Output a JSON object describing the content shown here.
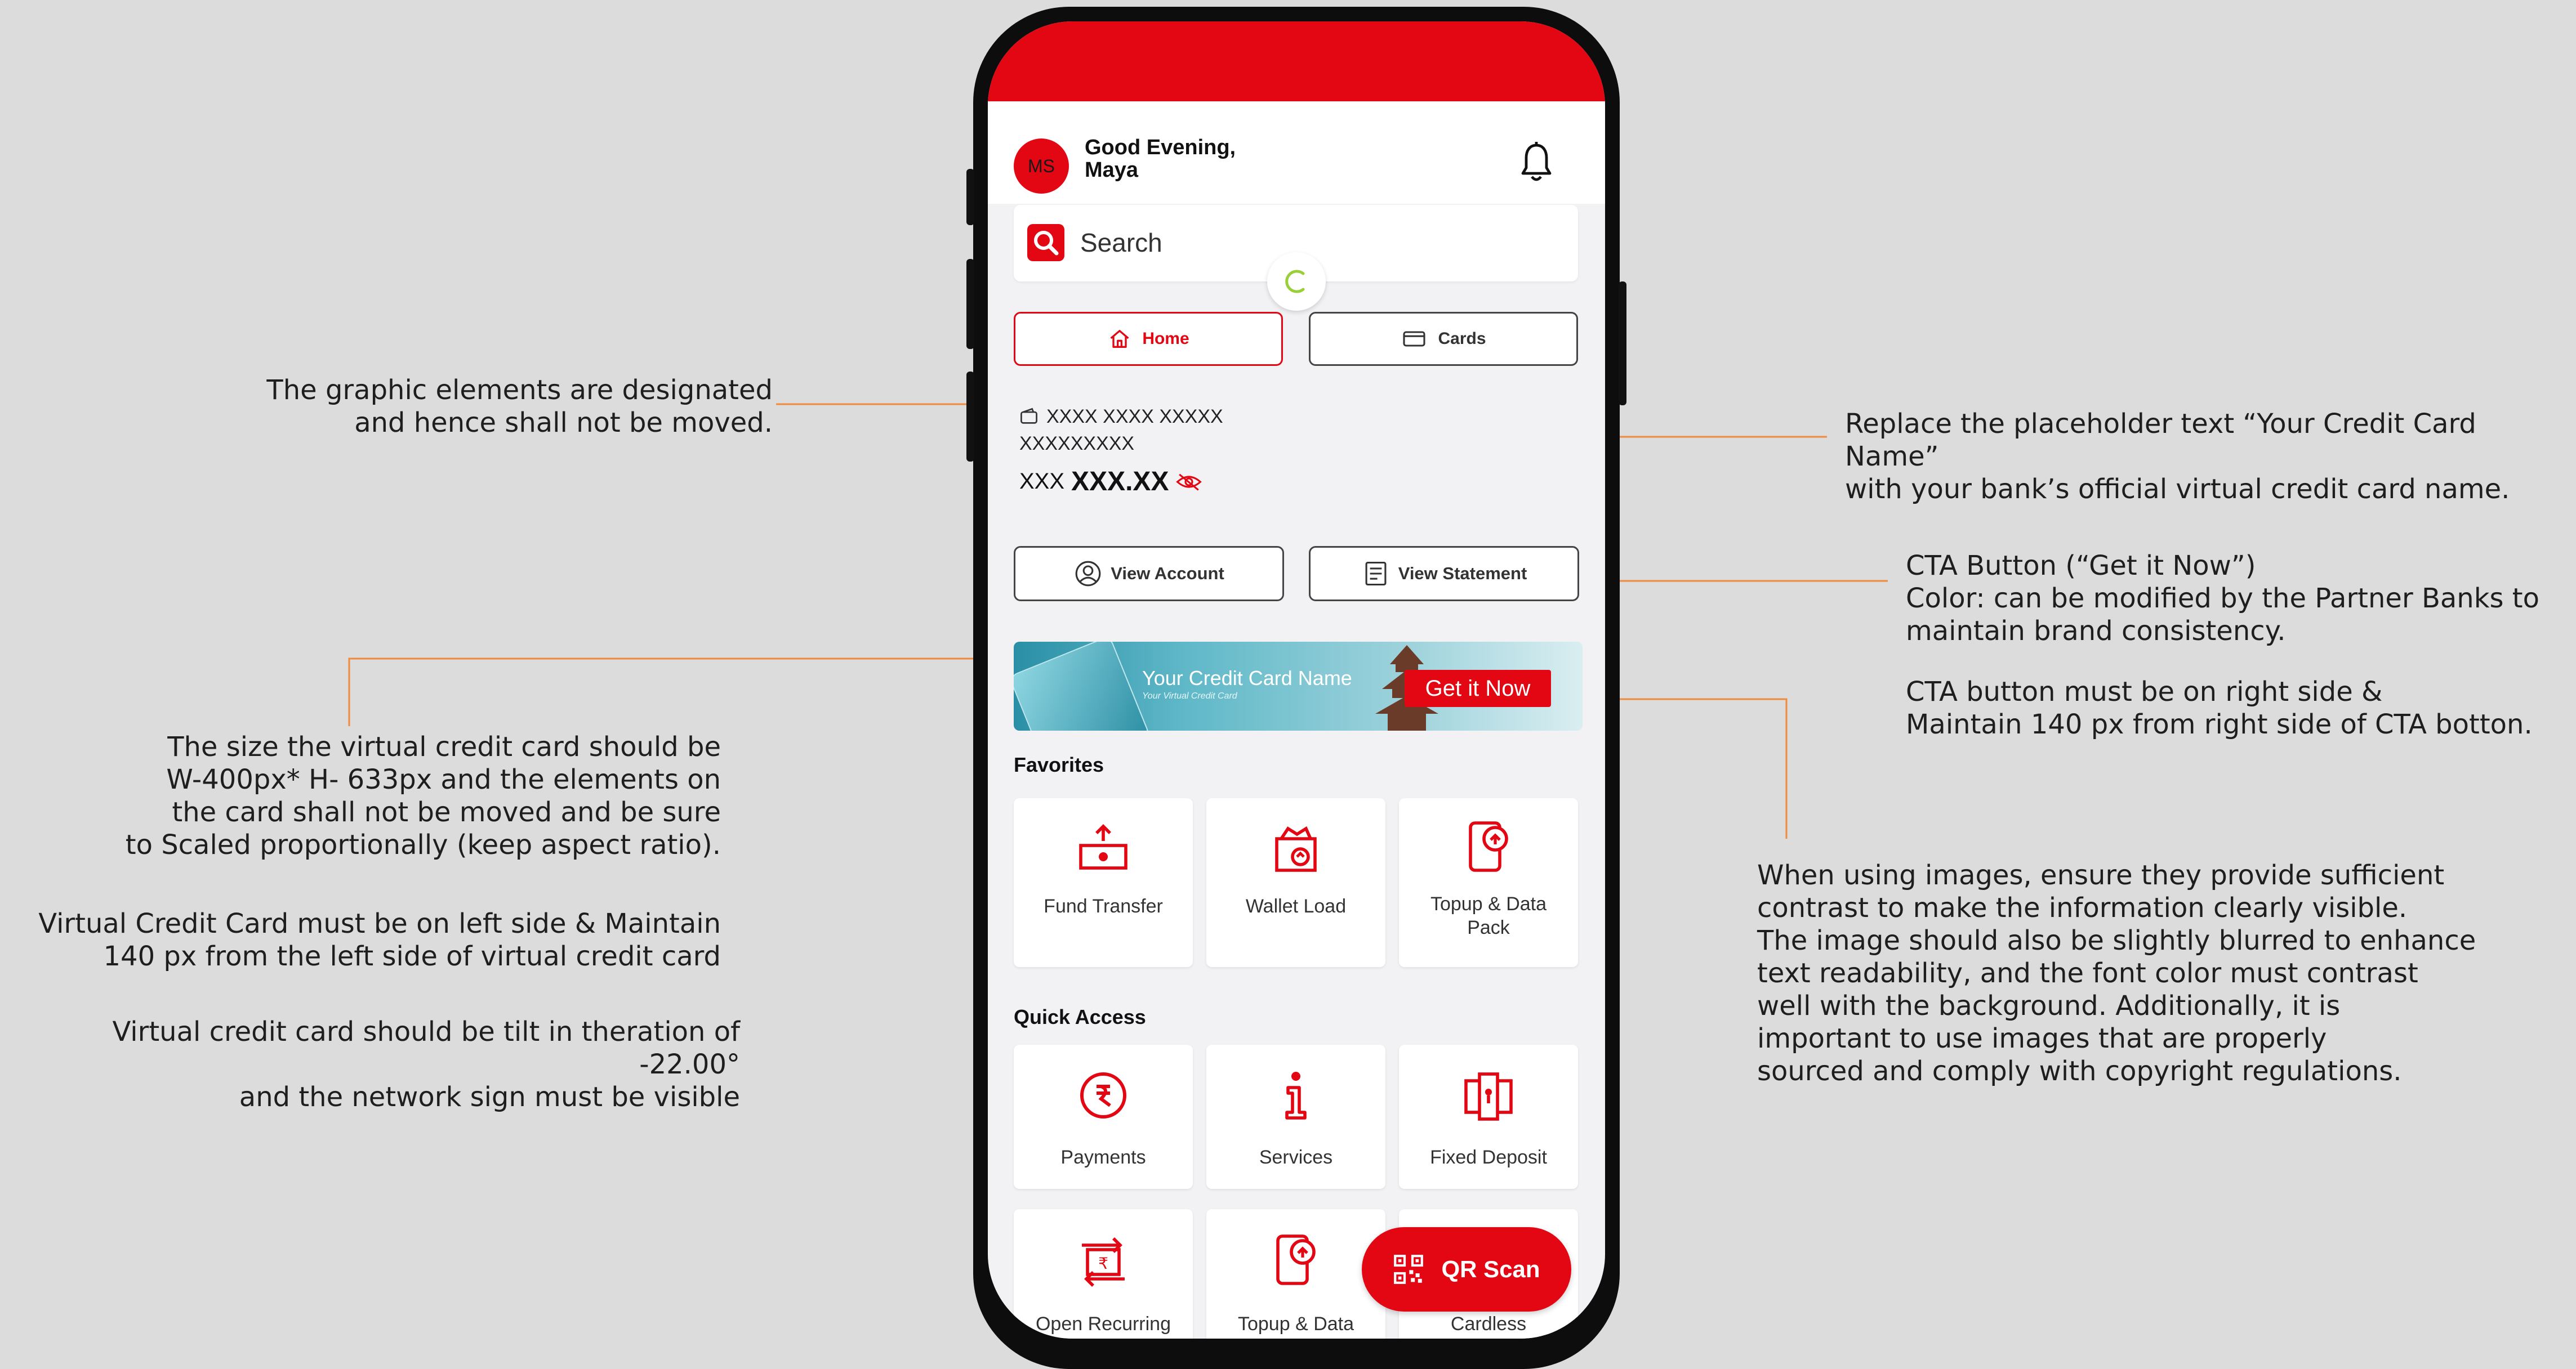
{
  "annotations": {
    "graphic_elements": [
      "The graphic elements are designated",
      "and hence shall not be moved."
    ],
    "card_size": [
      "The size the virtual credit card should be",
      "W-400px* H- 633px and the elements on",
      "the card shall not be moved and be sure",
      "to Scaled proportionally (keep aspect ratio)."
    ],
    "card_position": [
      "Virtual Credit Card must be on left side & Maintain",
      "140 px from the left side of virtual credit card"
    ],
    "card_tilt": [
      "Virtual credit card should be tilt in theration of -22.00°",
      "and the network sign must be visible"
    ],
    "card_name": [
      "Replace the placeholder text “Your Credit Card Name”",
      "with your bank’s official virtual credit card name."
    ],
    "cta_color": [
      "CTA Button (“Get it Now”)",
      "Color: can be modified by the Partner Banks to",
      "maintain brand consistency."
    ],
    "cta_position": [
      "CTA button must be on right side &",
      "Maintain 140 px from right side of CTA botton."
    ],
    "images": [
      "When using images, ensure they provide sufficient",
      "contrast to make the information clearly visible.",
      "The image should also be slightly blurred to enhance",
      "text readability, and the font color must contrast",
      "well with the background. Additionally, it is",
      "important to use images that are properly",
      "sourced and comply with copyright regulations."
    ]
  },
  "app": {
    "avatar_initials": "MS",
    "greeting_line1": "Good Evening,",
    "greeting_line2": "Maya",
    "search_placeholder": "Search",
    "tabs": {
      "home": "Home",
      "cards": "Cards"
    },
    "account_number_line1": "XXXX XXXX XXXXX",
    "account_number_line2": "XXXXXXXXX",
    "balance_currency": "XXX",
    "balance_amount": "XXX.XX",
    "view_account": "View Account",
    "view_statement": "View Statement",
    "banner": {
      "title": "Your Credit Card Name",
      "subtitle": "Your Virtual Credit Card",
      "cta": "Get it Now"
    },
    "favorites_title": "Favorites",
    "favorites": [
      {
        "label1": "Fund Transfer",
        "label2": "",
        "icon": "fund-transfer-icon"
      },
      {
        "label1": "Wallet Load",
        "label2": "",
        "icon": "wallet-load-icon"
      },
      {
        "label1": "Topup &  Data",
        "label2": "Pack",
        "icon": "topup-icon"
      }
    ],
    "quick_title": "Quick Access",
    "quick": [
      {
        "label": "Payments",
        "icon": "payments-icon"
      },
      {
        "label": "Services",
        "icon": "info-icon"
      },
      {
        "label": "Fixed Deposit",
        "icon": "fixed-deposit-icon"
      },
      {
        "label": "Open Recurring",
        "icon": "recurring-icon"
      },
      {
        "label": "Topup &  Data",
        "icon": "topup-icon"
      },
      {
        "label": "Cardless",
        "icon": "cardless-icon"
      }
    ],
    "qr_label": "QR Scan"
  },
  "colors": {
    "brand_red": "#e30613",
    "annotation_line": "#f08a3c",
    "background": "#dcdcdc"
  }
}
